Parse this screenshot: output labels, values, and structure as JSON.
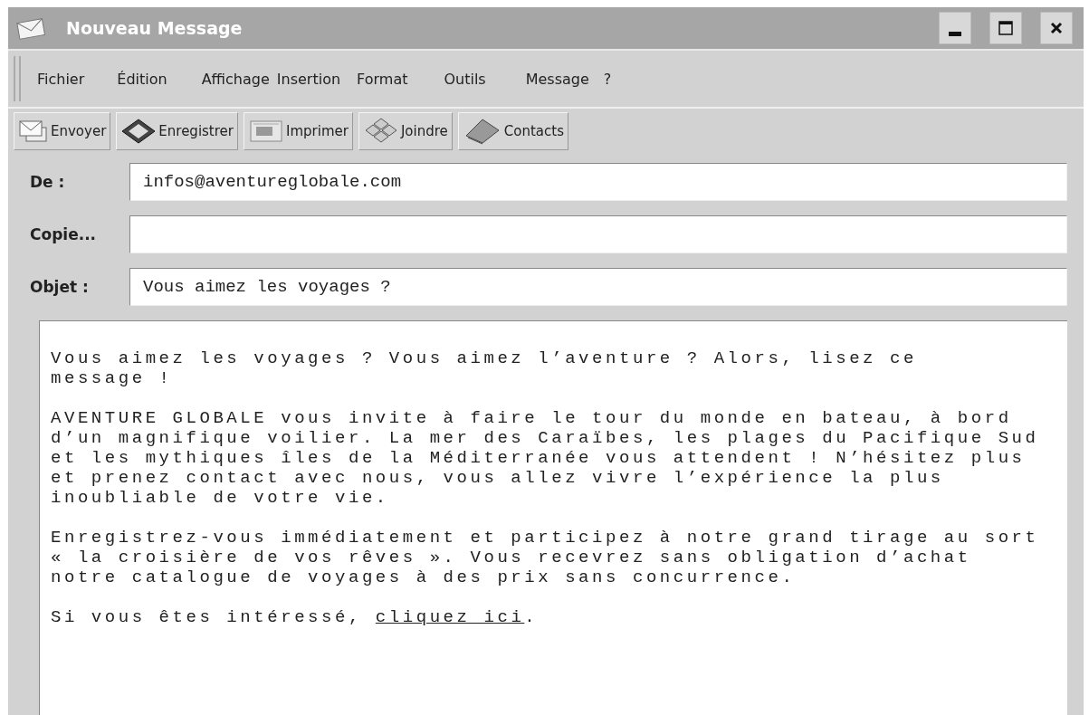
{
  "window": {
    "title": "Nouveau Message"
  },
  "menu": [
    "Fichier",
    "Édition",
    "Affichage",
    "Insertion",
    "Format",
    "Outils",
    "Message",
    "?"
  ],
  "toolbar": [
    {
      "kind": "send",
      "label": "Envoyer"
    },
    {
      "kind": "save",
      "label": "Enregistrer"
    },
    {
      "kind": "print",
      "label": "Imprimer"
    },
    {
      "kind": "attach",
      "label": "Joindre"
    },
    {
      "kind": "contacts",
      "label": "Contacts"
    }
  ],
  "fields": [
    {
      "label": "De :",
      "value": "infos@aventureglobale.com"
    },
    {
      "label": "Copie..."
    },
    {
      "label": "Objet :",
      "value": "Vous aimez les voyages ?"
    }
  ],
  "body": {
    "paragraphs": [
      "Vous aimez les voyages ? Vous aimez l’aventure ? Alors, lisez ce\nmessage !",
      "AVENTURE GLOBALE vous invite à faire le tour du monde en bateau, à bord\nd’un magnifique voilier. La mer des Caraïbes, les plages du Pacifique Sud\net les mythiques îles de la Méditerranée vous attendent ! N’hésitez plus\net prenez contact avec nous, vous allez vivre l’expérience la plus\ninoubliable de votre vie.",
      "Enregistrez-vous immédiatement et participez à notre grand tirage au sort\n« la croisière de vos rêves ». Vous recevrez sans obligation d’achat\nnotre catalogue de voyages à des prix sans concurrence."
    ],
    "closing": {
      "before": "Si vous êtes intéressé, ",
      "link": "cliquez ici",
      "after": "."
    }
  }
}
